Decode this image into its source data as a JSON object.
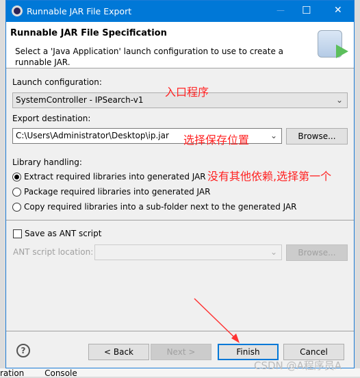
{
  "window": {
    "title": "Runnable JAR File Export",
    "minimize": "—",
    "maximize": "☐",
    "close": "✕"
  },
  "header": {
    "title": "Runnable JAR File Specification",
    "description": "Select a 'Java Application' launch configuration to use to create a runnable JAR."
  },
  "launch": {
    "label": "Launch configuration:",
    "value": "SystemController - IPSearch-v1"
  },
  "export": {
    "label": "Export destination:",
    "value": "C:\\Users\\Administrator\\Desktop\\ip.jar",
    "browse": "Browse..."
  },
  "library": {
    "label": "Library handling:",
    "options": [
      {
        "label": "Extract required libraries into generated JAR",
        "selected": true
      },
      {
        "label": "Package required libraries into generated JAR",
        "selected": false
      },
      {
        "label": "Copy required libraries into a sub-folder next to the generated JAR",
        "selected": false
      }
    ]
  },
  "ant": {
    "checkbox": "Save as ANT script",
    "checked": false,
    "location_label": "ANT script location:",
    "value": "",
    "browse": "Browse..."
  },
  "buttons": {
    "help": "?",
    "back": "< Back",
    "next": "Next >",
    "finish": "Finish",
    "cancel": "Cancel"
  },
  "annotations": {
    "launch": "入口程序",
    "export": "选择保存位置",
    "library": "没有其他依赖,选择第一个"
  },
  "background": {
    "tab1": "ration",
    "tab2": "Console"
  },
  "watermark": "CSDN @A程序员A",
  "colors": {
    "titlebar": "#0078d7",
    "annotation": "#ff2222",
    "focus": "#0078d7"
  }
}
